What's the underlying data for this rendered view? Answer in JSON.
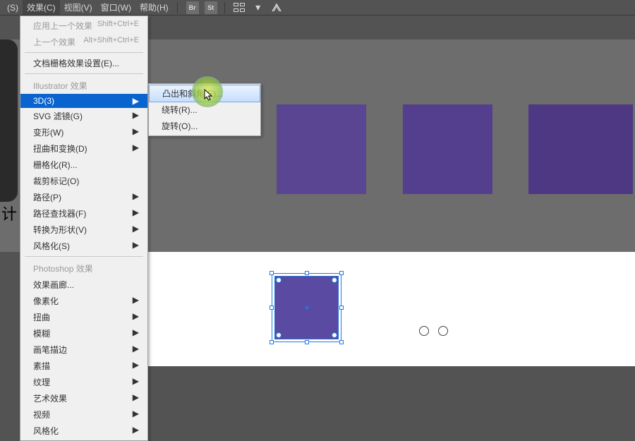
{
  "menubar": {
    "items": [
      {
        "label": "(S)"
      },
      {
        "label": "效果(C)"
      },
      {
        "label": "视图(V)"
      },
      {
        "label": "窗口(W)"
      },
      {
        "label": "帮助(H)"
      }
    ],
    "tool_br": "Br",
    "tool_st": "St"
  },
  "effects_menu": {
    "apply_last": {
      "label": "应用上一个效果",
      "shortcut": "Shift+Ctrl+E"
    },
    "last_effect": {
      "label": "上一个效果",
      "shortcut": "Alt+Shift+Ctrl+E"
    },
    "doc_raster": "文档栅格效果设置(E)...",
    "illustrator_header": "Illustrator 效果",
    "three_d": "3D(3)",
    "svg_filter": "SVG 滤镜(G)",
    "warp": "变形(W)",
    "distort_transform": "扭曲和变换(D)",
    "rasterize": "栅格化(R)...",
    "crop_marks": "裁剪标记(O)",
    "path": "路径(P)",
    "pathfinder": "路径查找器(F)",
    "convert_shape": "转换为形状(V)",
    "stylize_ai": "风格化(S)",
    "photoshop_header": "Photoshop 效果",
    "gallery": "效果画廊...",
    "pixelate": "像素化",
    "distort_ps": "扭曲",
    "blur": "模糊",
    "brush_strokes": "画笔描边",
    "sketch": "素描",
    "texture": "纹理",
    "artistic": "艺术效果",
    "video": "视频",
    "stylize_ps": "风格化",
    "arrow": "▶"
  },
  "submenu_3d": {
    "extrude": "凸出和斜角(E)...",
    "revolve": "绕转(R)...",
    "rotate": "旋转(O)..."
  },
  "left_char": "计"
}
